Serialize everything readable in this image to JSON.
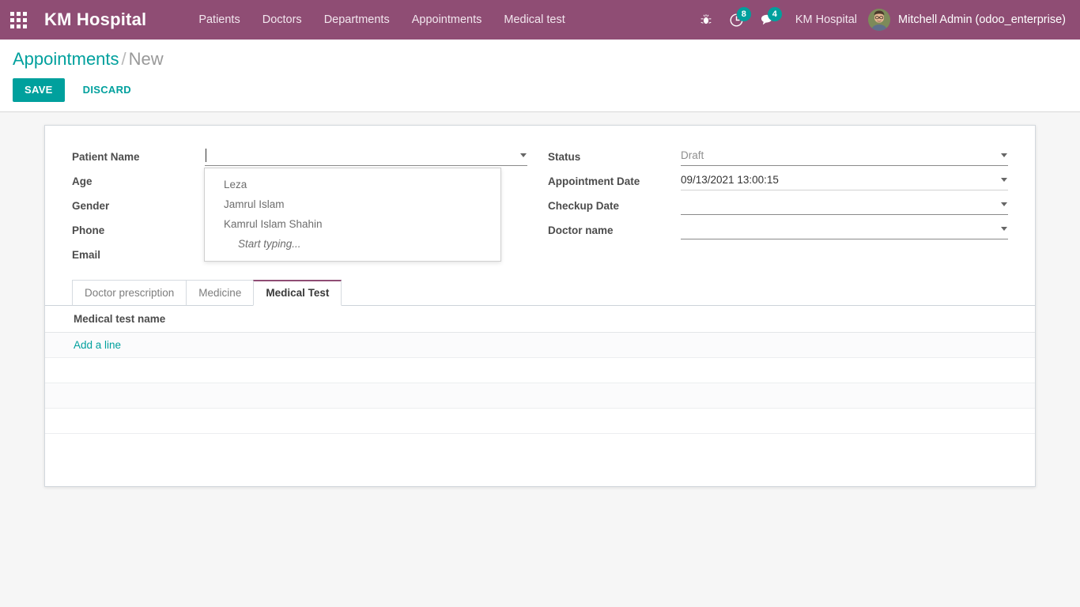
{
  "navbar": {
    "apps_icon": "apps-grid-icon",
    "brand": "KM Hospital",
    "menu": [
      {
        "label": "Patients"
      },
      {
        "label": "Doctors"
      },
      {
        "label": "Departments"
      },
      {
        "label": "Appointments"
      },
      {
        "label": "Medical test"
      }
    ],
    "icons": [
      {
        "name": "bug-icon",
        "badge": null
      },
      {
        "name": "activity-clock-icon",
        "badge": "8"
      },
      {
        "name": "messages-icon",
        "badge": "4"
      }
    ],
    "company": "KM Hospital",
    "user": "Mitchell Admin (odoo_enterprise)",
    "accent": "#8f4d74",
    "badge_color": "#00a09d"
  },
  "control_panel": {
    "breadcrumb_root": "Appointments",
    "breadcrumb_sep": "/",
    "breadcrumb_current": "New",
    "save_label": "SAVE",
    "discard_label": "DISCARD",
    "accent": "#00a09d"
  },
  "form": {
    "left": [
      {
        "label": "Patient Name",
        "value": "",
        "placeholder": "",
        "widget": "many2one"
      },
      {
        "label": "Age",
        "value": "",
        "placeholder": "",
        "widget": "char"
      },
      {
        "label": "Gender",
        "value": "",
        "placeholder": "",
        "widget": "char"
      },
      {
        "label": "Phone",
        "value": "",
        "placeholder": "",
        "widget": "char"
      },
      {
        "label": "Email",
        "value": "",
        "placeholder": "",
        "widget": "char"
      }
    ],
    "right": [
      {
        "label": "Status",
        "value": "Draft",
        "placeholder": "",
        "widget": "selection"
      },
      {
        "label": "Appointment Date",
        "value": "09/13/2021 13:00:15",
        "placeholder": "",
        "widget": "datetime"
      },
      {
        "label": "Checkup Date",
        "value": "",
        "placeholder": "",
        "widget": "datetime"
      },
      {
        "label": "Doctor name",
        "value": "",
        "placeholder": "",
        "widget": "many2one"
      }
    ],
    "autocomplete": {
      "open": true,
      "options": [
        "Leza",
        "Jamrul Islam",
        "Kamrul Islam Shahin"
      ],
      "hint": "Start typing..."
    }
  },
  "notebook": {
    "tabs": [
      {
        "label": "Doctor prescription",
        "active": false
      },
      {
        "label": "Medicine",
        "active": false
      },
      {
        "label": "Medical Test",
        "active": true
      }
    ],
    "active_tab_indicator_color": "#8f4d74",
    "list": {
      "columns": [
        "Medical test name"
      ],
      "rows": [],
      "add_line_label": "Add a line"
    }
  }
}
